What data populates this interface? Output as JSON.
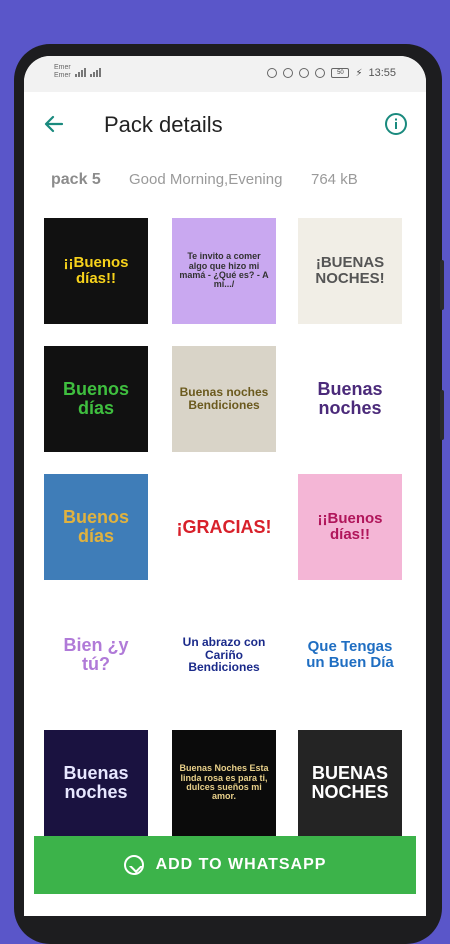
{
  "status_bar": {
    "carrier_line1": "Emer",
    "carrier_line2": "Emer",
    "battery": "50",
    "time": "13:55"
  },
  "appbar": {
    "title": "Pack details",
    "back_icon": "arrow-left-icon",
    "info_icon": "info-icon",
    "accent": "#1a8a7e"
  },
  "pack": {
    "name": "pack 5",
    "publisher": "Good Morning,Evening",
    "size": "764 kB"
  },
  "stickers": [
    {
      "text": "¡¡Buenos días!!",
      "bg": "#111111",
      "fg": "#f7d21b"
    },
    {
      "text": "Te invito a comer algo que hizo mi mamá - ¿Qué es? - A mí.../",
      "bg": "#c9a8f0",
      "fg": "#333333"
    },
    {
      "text": "¡BUENAS NOCHES!",
      "bg": "#f1eee6",
      "fg": "#555555"
    },
    {
      "text": "Buenos días",
      "bg": "#111111",
      "fg": "#3fbf3f"
    },
    {
      "text": "Buenas noches Bendiciones",
      "bg": "#d9d4c8",
      "fg": "#6b5a1e"
    },
    {
      "text": "Buenas noches",
      "bg": "#ffffff",
      "fg": "#4b2a7a"
    },
    {
      "text": "Buenos días",
      "bg": "#3f7db8",
      "fg": "#e0b23f"
    },
    {
      "text": "¡GRACIAS!",
      "bg": "#ffffff",
      "fg": "#d8202a"
    },
    {
      "text": "¡¡Buenos días!!",
      "bg": "#f4b6d6",
      "fg": "#b0155a"
    },
    {
      "text": "Bien ¿y tú?",
      "bg": "#ffffff",
      "fg": "#b07ad8"
    },
    {
      "text": "Un abrazo con Cariño Bendiciones",
      "bg": "#ffffff",
      "fg": "#1a2a8a"
    },
    {
      "text": "Que Tengas un Buen Día",
      "bg": "#ffffff",
      "fg": "#1f6ec2"
    },
    {
      "text": "Buenas noches",
      "bg": "#1a1240",
      "fg": "#e7e7ff"
    },
    {
      "text": "Buenas Noches Esta linda rosa es para ti, dulces sueños mi amor.",
      "bg": "#0b0b0b",
      "fg": "#e8d08a"
    },
    {
      "text": "BUENAS NOCHES",
      "bg": "#242424",
      "fg": "#ffffff"
    }
  ],
  "add_button": {
    "label": "ADD TO WHATSAPP",
    "icon": "whatsapp-icon",
    "color": "#3cb34a"
  }
}
